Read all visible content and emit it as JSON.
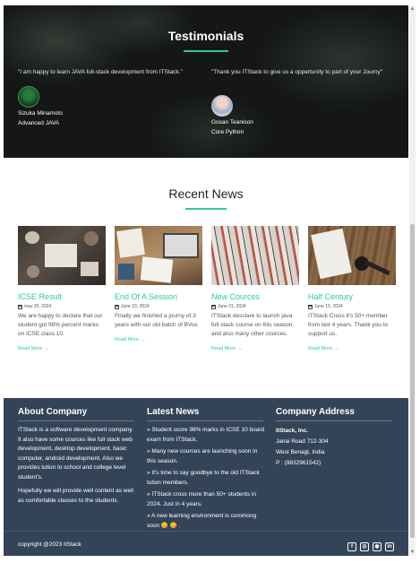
{
  "testimonials": {
    "title": "Testimonials",
    "items": [
      {
        "quote": "\"I am happy to learn JAVA full-stack development from ITStack.\"",
        "name": "Sizuka Minamoto",
        "course": "Advanced JAVA"
      },
      {
        "quote": "\"Thank you ITStack to give us a oppertunity to part of your Journy\"",
        "name": "Gosan Teanison",
        "course": "Core Python"
      }
    ]
  },
  "news": {
    "title": "Recent News",
    "read_more": "Read More",
    "arrow": "→",
    "cards": [
      {
        "title": "ICSE Result",
        "date": "may 20, 2024",
        "text": "We are happy to declare that our student got 98% percent marks on ICSE class 10."
      },
      {
        "title": "End Of A Session",
        "date": "June 23, 2024",
        "text": "Finally we finished a journy of 3 years with our old batch of BVoc"
      },
      {
        "title": "New Cources",
        "date": "June 21, 2024",
        "text": "ITStack desclare to launch java full stack course on this season. and also many other cources."
      },
      {
        "title": "Half Century",
        "date": "June 15, 2024",
        "text": "ITStack Cross it's 50+ member from last 4 years. Thank you to support us."
      }
    ]
  },
  "footer": {
    "about": {
      "title": "About Company",
      "p1": "ITStack is a software development company. It also have some cources like full stack web development, desktop development, basic computer, android development. Also we provides tution to school and college level student's.",
      "p2": "Hopefully we will provide well content as well as comfortable classes to the students."
    },
    "latest": {
      "title": "Latest News",
      "items": [
        "» Student score 98% marks in ICSE 10 board exam from ITStack.",
        "» Many new cources are launching soon in this season.",
        "» It's time to say goodbye to the old ITStack tution members.",
        "» ITStack cross more than 50+ students in 2024. Just in 4 years.",
        "» A new learning environment is commong soon 😋 😋 ."
      ]
    },
    "address": {
      "title": "Company Address",
      "name": "ItStack, Inc.",
      "line1": "Janai Road 712-304",
      "line2": "West Benagl, India",
      "phone": "P : (9832961542)"
    },
    "copyright": "copyright @2023 ItStack",
    "socials": [
      {
        "icon": "facebook-icon",
        "glyph": "f"
      },
      {
        "icon": "instagram-icon",
        "glyph": "◎"
      },
      {
        "icon": "github-icon",
        "glyph": "◉"
      },
      {
        "icon": "linkedin-icon",
        "glyph": "in"
      }
    ]
  },
  "colors": {
    "accent": "#2ecc8f",
    "footer_bg": "#344458"
  }
}
